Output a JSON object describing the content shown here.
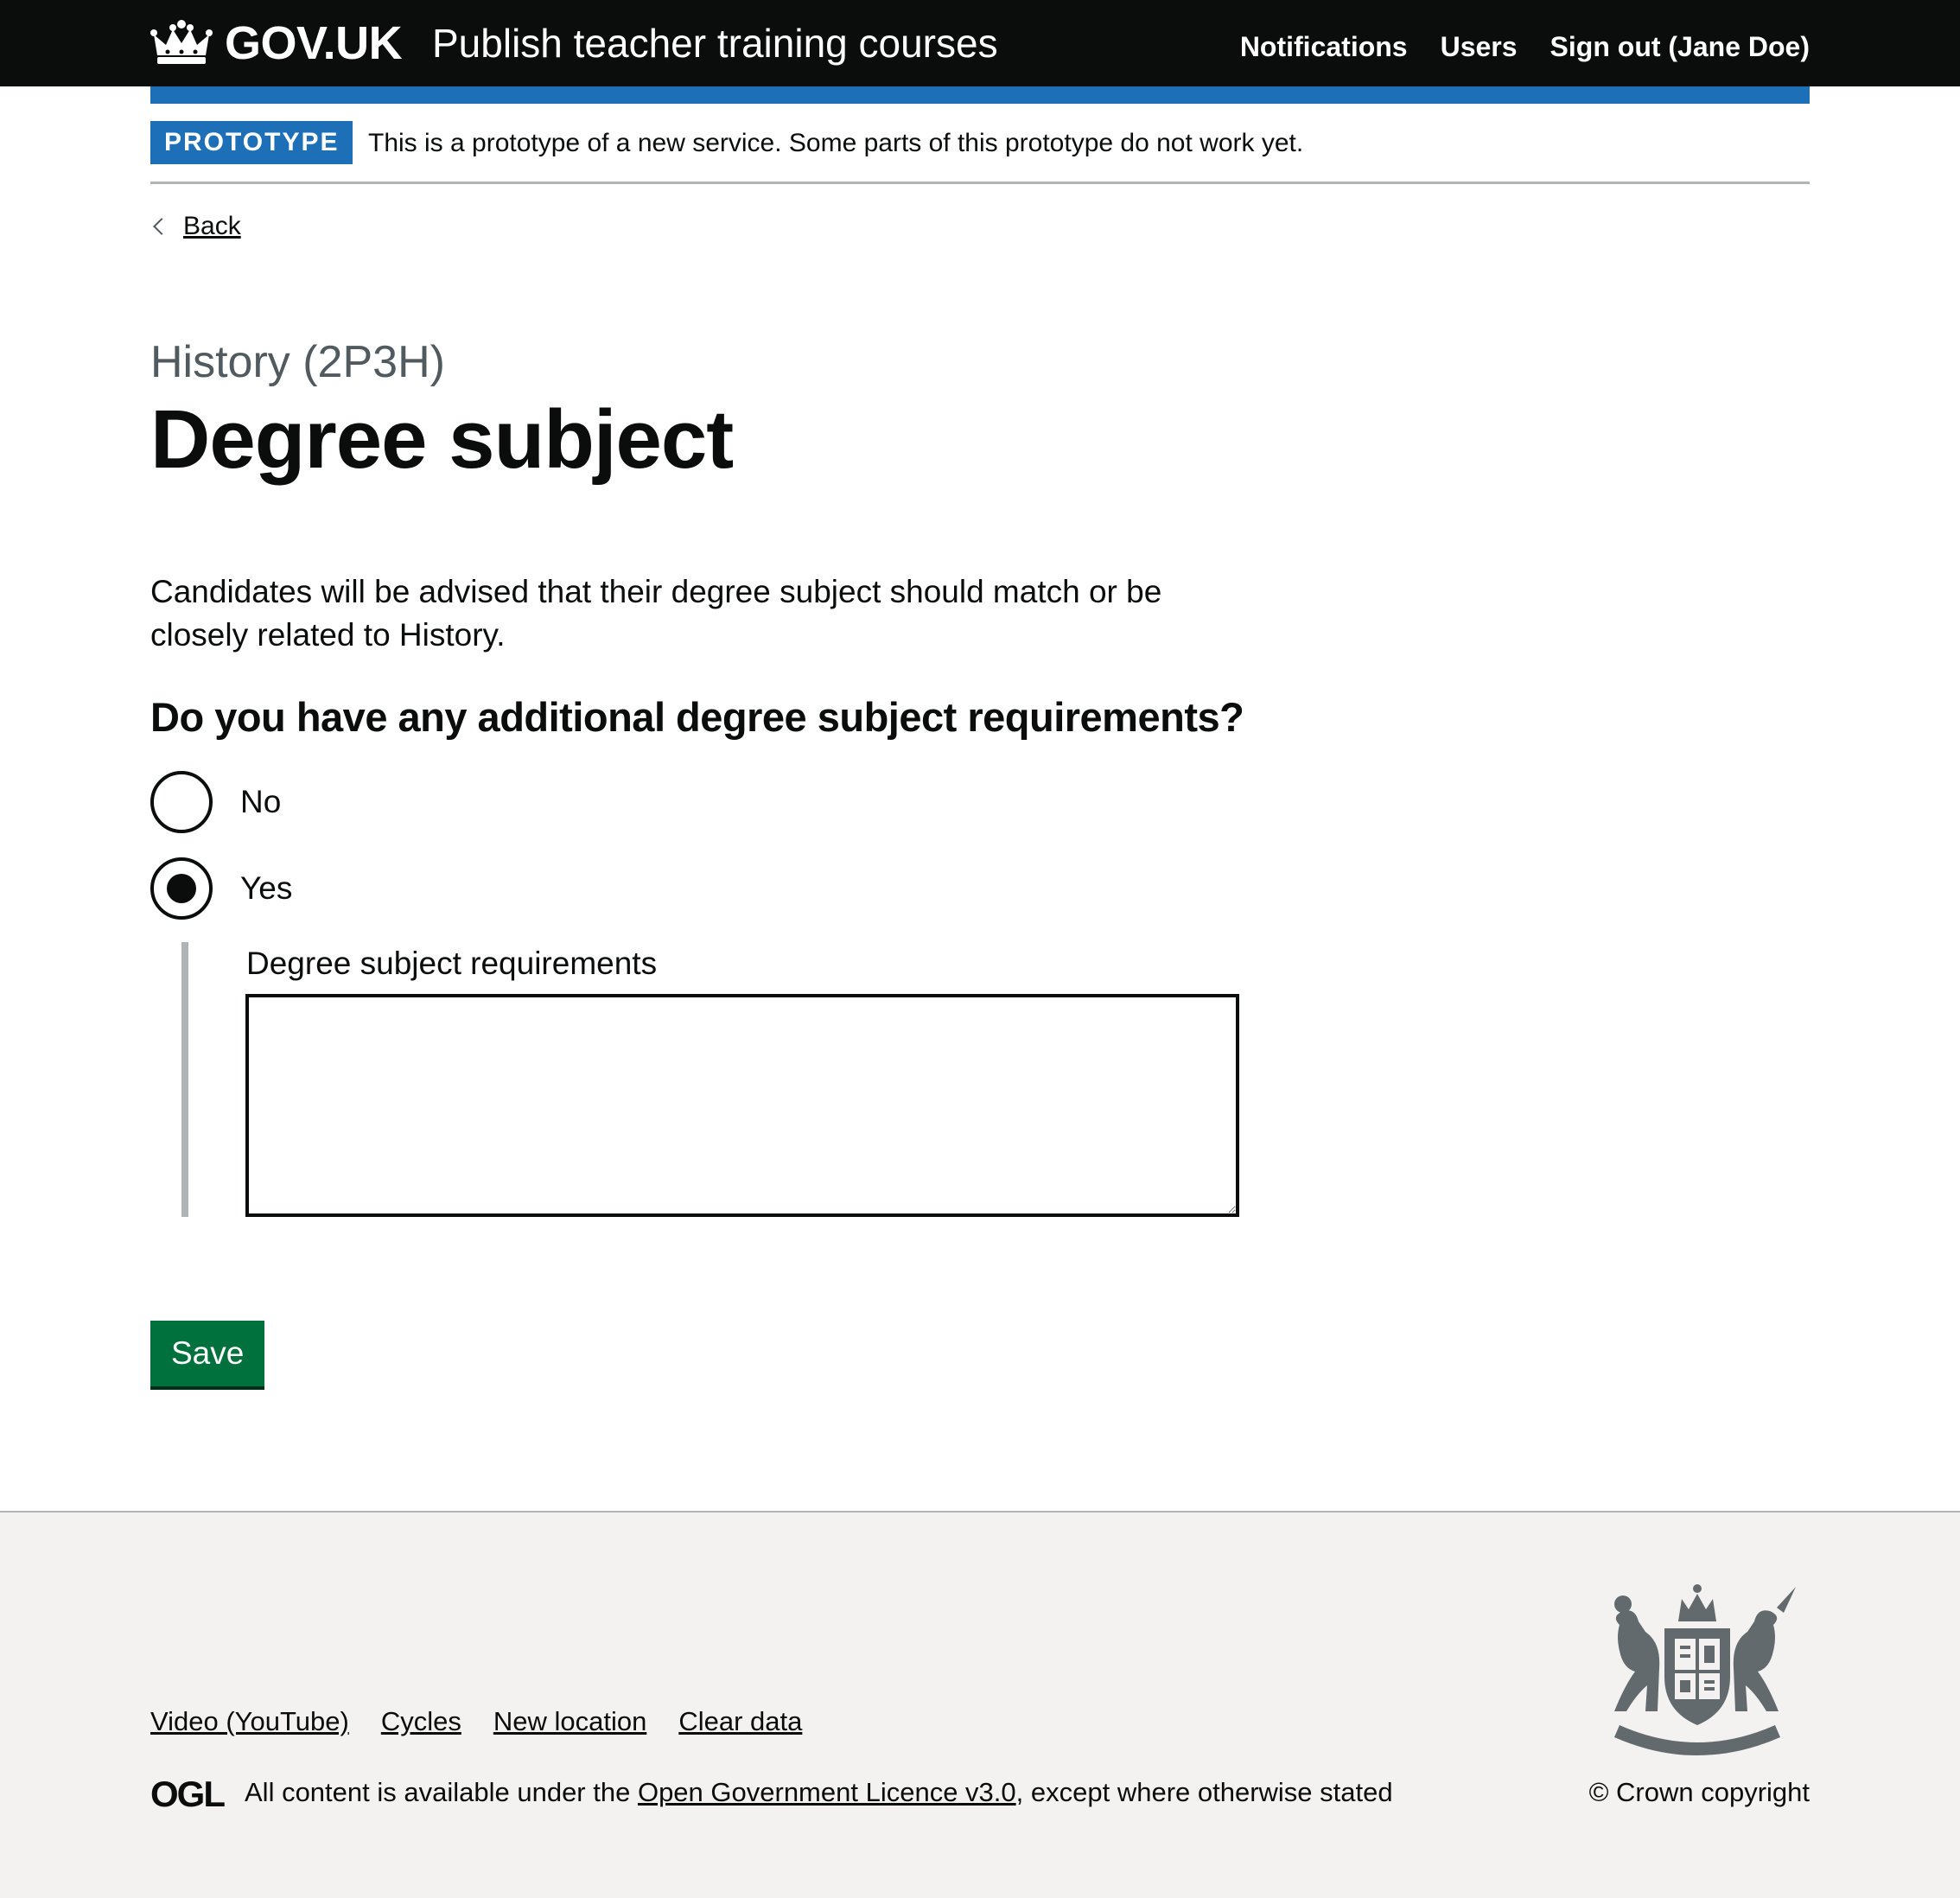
{
  "header": {
    "logo_text": "GOV.UK",
    "service_name": "Publish teacher training courses",
    "nav": [
      {
        "label": "Notifications"
      },
      {
        "label": "Users"
      },
      {
        "label": "Sign out (Jane Doe)"
      }
    ]
  },
  "phase_banner": {
    "tag": "PROTOTYPE",
    "text": "This is a prototype of a new service. Some parts of this prototype do not work yet."
  },
  "back_link": {
    "label": "Back"
  },
  "page": {
    "caption": "History (2P3H)",
    "title": "Degree subject",
    "body": "Candidates will be advised that their degree subject should match or be closely related to History."
  },
  "question": {
    "legend": "Do you have any additional degree subject requirements?",
    "options": [
      {
        "label": "No",
        "selected": false
      },
      {
        "label": "Yes",
        "selected": true
      }
    ],
    "conditional": {
      "label": "Degree subject requirements",
      "value": ""
    }
  },
  "buttons": {
    "save_label": "Save"
  },
  "footer": {
    "links": [
      {
        "label": "Video (YouTube)"
      },
      {
        "label": "Cycles"
      },
      {
        "label": "New location"
      },
      {
        "label": "Clear data"
      }
    ],
    "ogl_logo": "OGL",
    "licence_before": "All content is available under the ",
    "licence_link": "Open Government Licence v3.0",
    "licence_after": ", except where otherwise stated",
    "copyright": "© Crown copyright"
  },
  "colors": {
    "header_bg": "#0b0c0c",
    "brand_blue": "#1d70b8",
    "button_green": "#00703c",
    "footer_bg": "#f3f2f1"
  },
  "icons": {
    "logo": "crown-icon",
    "back": "chevron-left-icon",
    "footer_crest": "royal-coat-of-arms-icon"
  }
}
